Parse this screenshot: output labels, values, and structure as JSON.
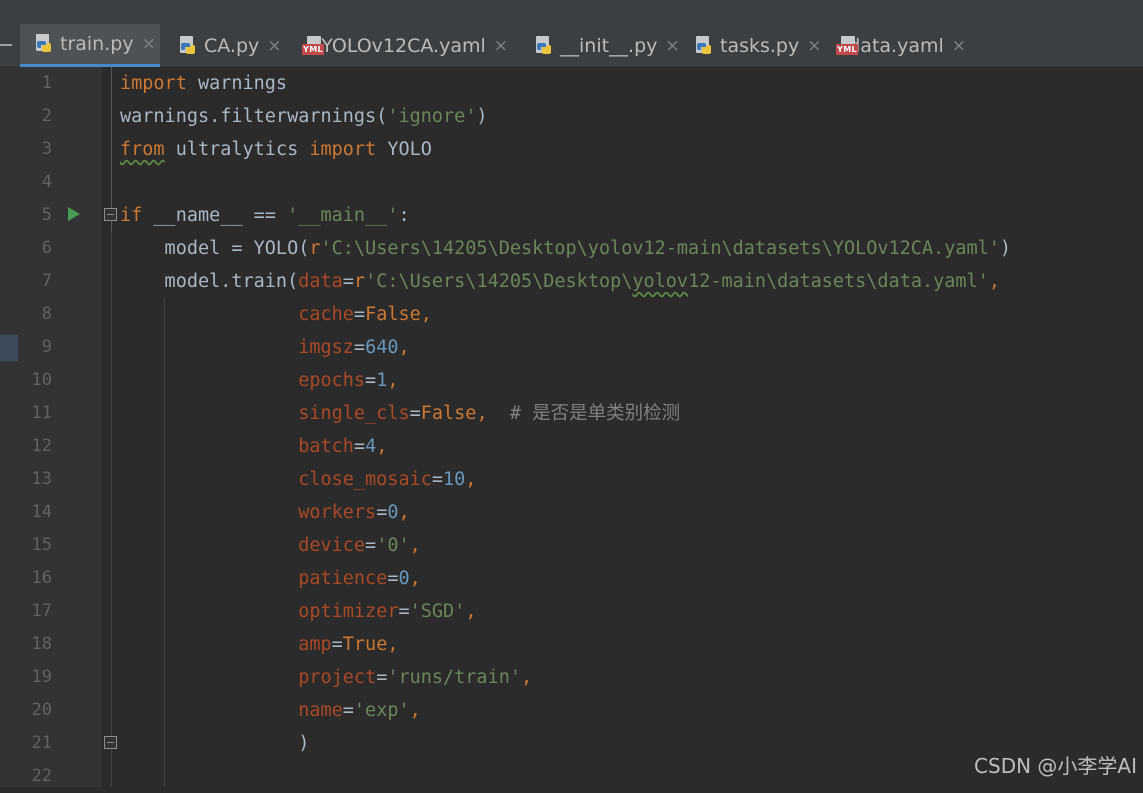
{
  "tabs": [
    {
      "label": "train.py",
      "icon": "python-file-icon",
      "active": true
    },
    {
      "label": "CA.py",
      "icon": "python-file-icon",
      "active": false
    },
    {
      "label": "YOLOv12CA.yaml",
      "icon": "yaml-file-icon",
      "active": false
    },
    {
      "label": "__init__.py",
      "icon": "python-file-icon",
      "active": false
    },
    {
      "label": "tasks.py",
      "icon": "python-file-icon",
      "active": false
    },
    {
      "label": "data.yaml",
      "icon": "yaml-file-icon",
      "active": false
    }
  ],
  "tab_close_glyph": "×",
  "yaml_badge": "YML",
  "code": {
    "line_numbers": [
      "1",
      "2",
      "3",
      "4",
      "5",
      "6",
      "7",
      "8",
      "9",
      "10",
      "11",
      "12",
      "13",
      "14",
      "15",
      "16",
      "17",
      "18",
      "19",
      "20",
      "21",
      "22"
    ],
    "lines": [
      [
        [
          "kw",
          "import"
        ],
        [
          "txt",
          " warnings"
        ]
      ],
      [
        [
          "txt",
          "warnings.filterwarnings("
        ],
        [
          "str",
          "'ignore'"
        ],
        [
          "txt",
          ")"
        ]
      ],
      [
        [
          "kw wavy",
          "from"
        ],
        [
          "txt",
          " ultralytics "
        ],
        [
          "kw",
          "import"
        ],
        [
          "txt",
          " YOLO"
        ]
      ],
      [],
      [
        [
          "kw",
          "if"
        ],
        [
          "txt",
          " __name__ == "
        ],
        [
          "str",
          "'__main__'"
        ],
        [
          "txt",
          ":"
        ]
      ],
      [
        [
          "txt",
          "    model = YOLO("
        ],
        [
          "kw",
          "r"
        ],
        [
          "str",
          "'C:\\Users\\14205\\Desktop\\yolov12-main\\datasets\\YOLOv12CA.yaml'"
        ],
        [
          "txt",
          ")"
        ]
      ],
      [
        [
          "txt",
          "    model.train("
        ],
        [
          "param",
          "data"
        ],
        [
          "txt",
          "="
        ],
        [
          "kw",
          "r"
        ],
        [
          "str",
          "'C:\\Users\\14205\\Desktop\\"
        ],
        [
          "str wavy",
          "yolov"
        ],
        [
          "str",
          "12-main\\datasets\\data.yaml'"
        ],
        [
          "kw",
          ","
        ]
      ],
      [
        [
          "txt",
          "                "
        ],
        [
          "param",
          "cache"
        ],
        [
          "txt",
          "="
        ],
        [
          "kw",
          "False,"
        ]
      ],
      [
        [
          "txt",
          "                "
        ],
        [
          "param",
          "imgsz"
        ],
        [
          "txt",
          "="
        ],
        [
          "num",
          "640"
        ],
        [
          "kw",
          ","
        ]
      ],
      [
        [
          "txt",
          "                "
        ],
        [
          "param",
          "epochs"
        ],
        [
          "txt",
          "="
        ],
        [
          "num",
          "1"
        ],
        [
          "kw",
          ","
        ]
      ],
      [
        [
          "txt",
          "                "
        ],
        [
          "param",
          "single_cls"
        ],
        [
          "txt",
          "="
        ],
        [
          "kw",
          "False,"
        ],
        [
          "cmt",
          "  # 是否是单类别检测"
        ]
      ],
      [
        [
          "txt",
          "                "
        ],
        [
          "param",
          "batch"
        ],
        [
          "txt",
          "="
        ],
        [
          "num",
          "4"
        ],
        [
          "kw",
          ","
        ]
      ],
      [
        [
          "txt",
          "                "
        ],
        [
          "param",
          "close_mosaic"
        ],
        [
          "txt",
          "="
        ],
        [
          "num",
          "10"
        ],
        [
          "kw",
          ","
        ]
      ],
      [
        [
          "txt",
          "                "
        ],
        [
          "param",
          "workers"
        ],
        [
          "txt",
          "="
        ],
        [
          "num",
          "0"
        ],
        [
          "kw",
          ","
        ]
      ],
      [
        [
          "txt",
          "                "
        ],
        [
          "param",
          "device"
        ],
        [
          "txt",
          "="
        ],
        [
          "str",
          "'0'"
        ],
        [
          "kw",
          ","
        ]
      ],
      [
        [
          "txt",
          "                "
        ],
        [
          "param",
          "patience"
        ],
        [
          "txt",
          "="
        ],
        [
          "num",
          "0"
        ],
        [
          "kw",
          ","
        ]
      ],
      [
        [
          "txt",
          "                "
        ],
        [
          "param",
          "optimizer"
        ],
        [
          "txt",
          "="
        ],
        [
          "str",
          "'SGD'"
        ],
        [
          "kw",
          ","
        ]
      ],
      [
        [
          "txt",
          "                "
        ],
        [
          "param",
          "amp"
        ],
        [
          "txt",
          "="
        ],
        [
          "kw",
          "True,"
        ]
      ],
      [
        [
          "txt",
          "                "
        ],
        [
          "param",
          "project"
        ],
        [
          "txt",
          "="
        ],
        [
          "str",
          "'runs/train'"
        ],
        [
          "kw",
          ","
        ]
      ],
      [
        [
          "txt",
          "                "
        ],
        [
          "param",
          "name"
        ],
        [
          "txt",
          "="
        ],
        [
          "str",
          "'exp'"
        ],
        [
          "kw",
          ","
        ]
      ],
      [
        [
          "txt",
          "                )"
        ]
      ],
      []
    ]
  },
  "watermark": "CSDN @小李学AI",
  "colors": {
    "keyword": "#cc7832",
    "string": "#6a8759",
    "number": "#6897bb",
    "param": "#aa4926",
    "comment": "#808080",
    "text": "#a9b7c6",
    "background": "#2b2b2b"
  }
}
